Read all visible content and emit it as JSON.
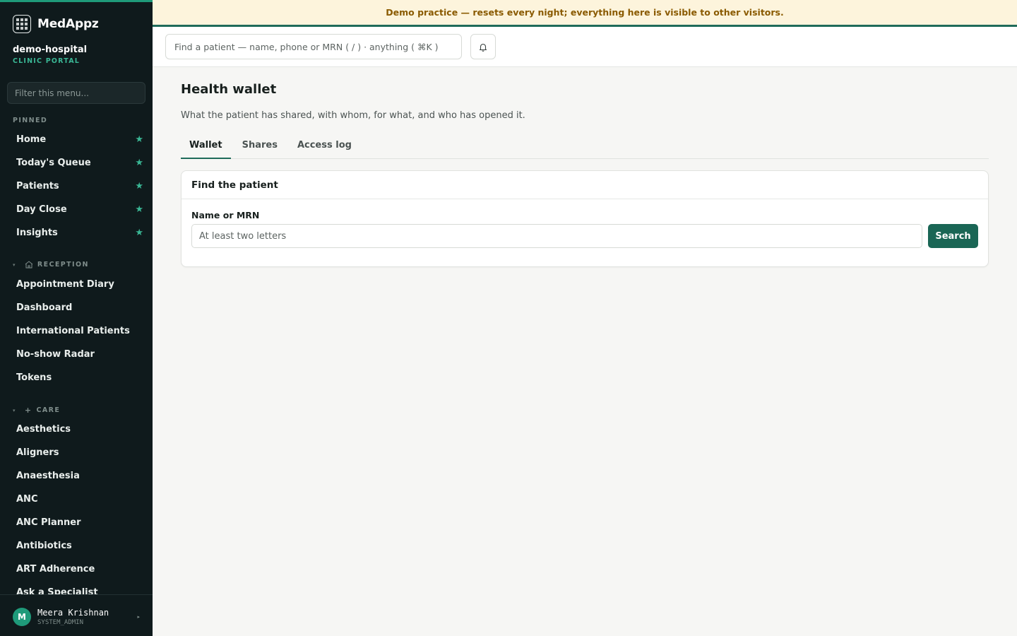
{
  "banner": {
    "text": "Demo practice — resets every night; everything here is visible to other visitors."
  },
  "brand": {
    "name": "MedAppz",
    "icon": "grid-logo-icon"
  },
  "org": {
    "name": "demo-hospital",
    "subtitle": "CLINIC PORTAL"
  },
  "sidebar": {
    "filter_placeholder": "Filter this menu...",
    "pinned_label": "PINNED",
    "pinned": [
      {
        "label": "Home"
      },
      {
        "label": "Today's Queue"
      },
      {
        "label": "Patients"
      },
      {
        "label": "Day Close"
      },
      {
        "label": "Insights"
      }
    ],
    "reception_label": "RECEPTION",
    "reception": [
      {
        "label": "Appointment Diary"
      },
      {
        "label": "Dashboard"
      },
      {
        "label": "International Patients"
      },
      {
        "label": "No-show Radar"
      },
      {
        "label": "Tokens"
      }
    ],
    "care_label": "CARE",
    "care": [
      {
        "label": "Aesthetics"
      },
      {
        "label": "Aligners"
      },
      {
        "label": "Anaesthesia"
      },
      {
        "label": "ANC"
      },
      {
        "label": "ANC Planner"
      },
      {
        "label": "Antibiotics"
      },
      {
        "label": "ART Adherence"
      },
      {
        "label": "Ask a Specialist"
      }
    ]
  },
  "user": {
    "initial": "M",
    "name": "Meera Krishnan",
    "role": "SYSTEM_ADMIN"
  },
  "topbar": {
    "search_placeholder": "Find a patient — name, phone or MRN ( / ) · anything ( ⌘K )"
  },
  "page": {
    "title": "Health wallet",
    "description": "What the patient has shared, with whom, for what, and who has opened it.",
    "tabs": [
      {
        "label": "Wallet"
      },
      {
        "label": "Shares"
      },
      {
        "label": "Access log"
      }
    ],
    "active_tab": "Wallet"
  },
  "card": {
    "title": "Find the patient",
    "field_label": "Name or MRN",
    "field_placeholder": "At least two letters",
    "button_label": "Search"
  },
  "colors": {
    "accent": "#1a6655",
    "sidebar_bg": "#0f1a1c",
    "banner_bg": "#fdf4dc",
    "banner_text": "#8a5a00",
    "star": "#3ab795"
  }
}
